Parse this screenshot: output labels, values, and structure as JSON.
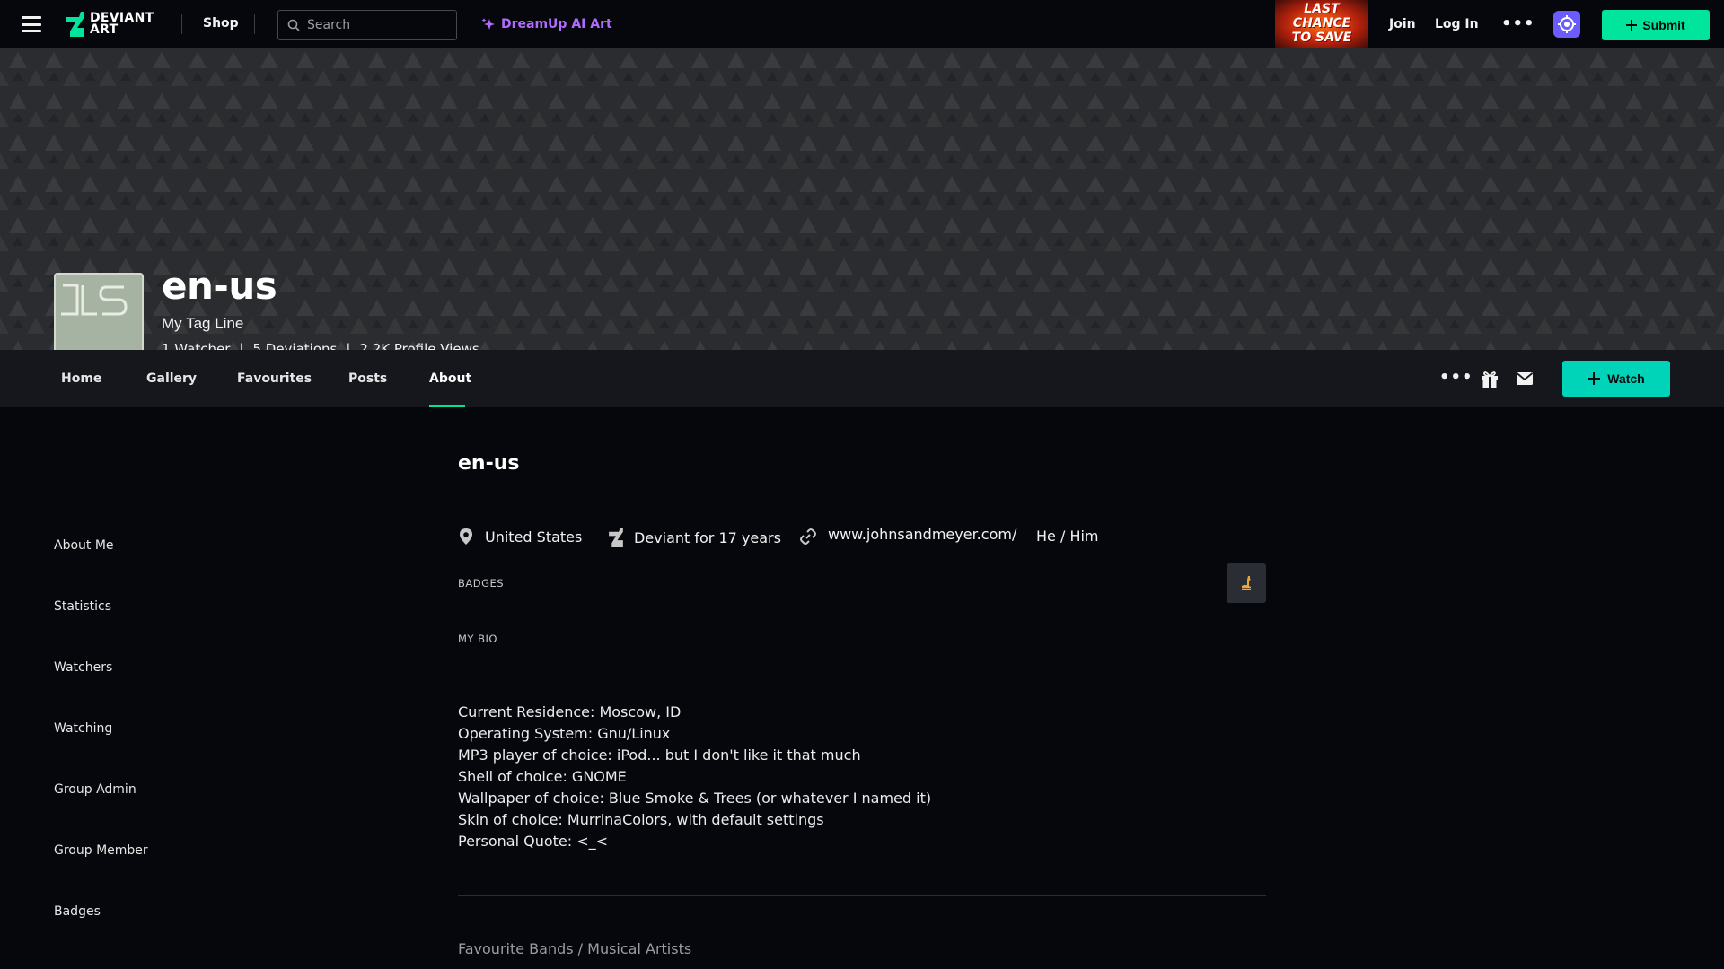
{
  "topbar": {
    "logo_line1": "DEVIANT",
    "logo_line2": "ART",
    "shop_label": "Shop",
    "search_placeholder": "Search",
    "dreamup_label": "DreamUp AI Art",
    "promo_line1": "LAST",
    "promo_line2": "CHANCE",
    "promo_line3": "TO SAVE",
    "join_label": "Join",
    "login_label": "Log In",
    "more_label": "•••",
    "submit_label": "Submit"
  },
  "profile": {
    "username": "en-us",
    "tagline": "My Tag Line",
    "stats": [
      "1 Watcher",
      "5 Deviations",
      "2.2K Profile Views"
    ],
    "stat_separator": "|"
  },
  "profile_nav": {
    "tabs": [
      {
        "label": "Home"
      },
      {
        "label": "Gallery"
      },
      {
        "label": "Favourites"
      },
      {
        "label": "Posts"
      },
      {
        "label": "About"
      }
    ],
    "active_tab": "About",
    "more_label": "•••",
    "watch_label": "Watch"
  },
  "sidebar": {
    "items": [
      {
        "label": "About Me"
      },
      {
        "label": "Statistics"
      },
      {
        "label": "Watchers"
      },
      {
        "label": "Watching"
      },
      {
        "label": "Group Admin"
      },
      {
        "label": "Group Member"
      },
      {
        "label": "Badges"
      }
    ]
  },
  "about": {
    "title": "en-us",
    "location": "United States",
    "deviant_for": "Deviant for 17 years",
    "website": "www.johnsandmeyer.com/",
    "pronouns": "He / Him",
    "badges_label": "BADGES",
    "bio_label": "MY BIO",
    "bio_lines": [
      "Current Residence: Moscow, ID",
      "Operating System: Gnu/Linux",
      "MP3 player of choice: iPod... but I don't like it that much",
      "Shell of choice: GNOME",
      "Wallpaper of choice: Blue Smoke & Trees (or whatever I named it)",
      "Skin of choice: MurrinaColors, with default settings",
      "Personal Quote: <_<"
    ],
    "fav_bands_label": "Favourite Bands / Musical Artists"
  },
  "colors": {
    "accent_green": "#00e59b",
    "watch_teal": "#00d4b8",
    "dreamup_purple": "#b36bff",
    "bot_purple": "#6b5cff",
    "background": "#06070d"
  },
  "icons": {
    "menu": "hamburger-icon",
    "search": "search-icon",
    "dreamup": "sparkle-icon",
    "location": "location-pin-icon",
    "deviant": "deviantart-logo-icon",
    "link": "link-icon",
    "gift": "gift-icon",
    "mail": "mail-icon",
    "plus": "plus-icon",
    "badge": "llama-badge-icon"
  }
}
